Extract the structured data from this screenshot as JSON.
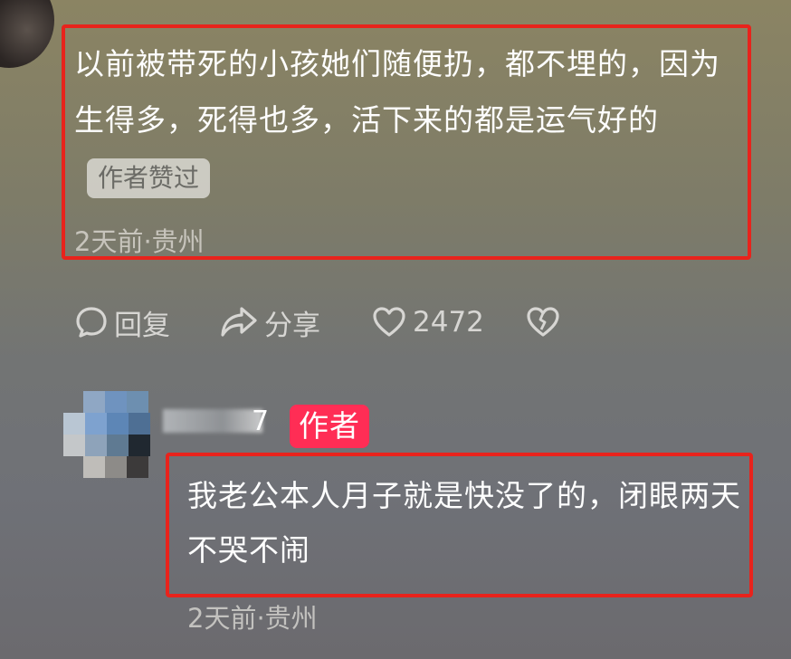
{
  "comment": {
    "text": "以前被带死的小孩她们随便扔，都不埋的，因为生得多，死得也多，活下来的都是运气好的",
    "liked_badge": "作者赞过",
    "meta": "2天前·贵州"
  },
  "actions": {
    "reply_label": "回复",
    "share_label": "分享",
    "like_count": "2472"
  },
  "reply": {
    "name_tail": "7",
    "author_badge": "作者",
    "text": "我老公本人月子就是快没了的，闭眼两天不哭不闹",
    "meta": "2天前·贵州"
  },
  "colors": {
    "highlight_border": "#e8231c",
    "author_badge": "#ff2d55"
  }
}
